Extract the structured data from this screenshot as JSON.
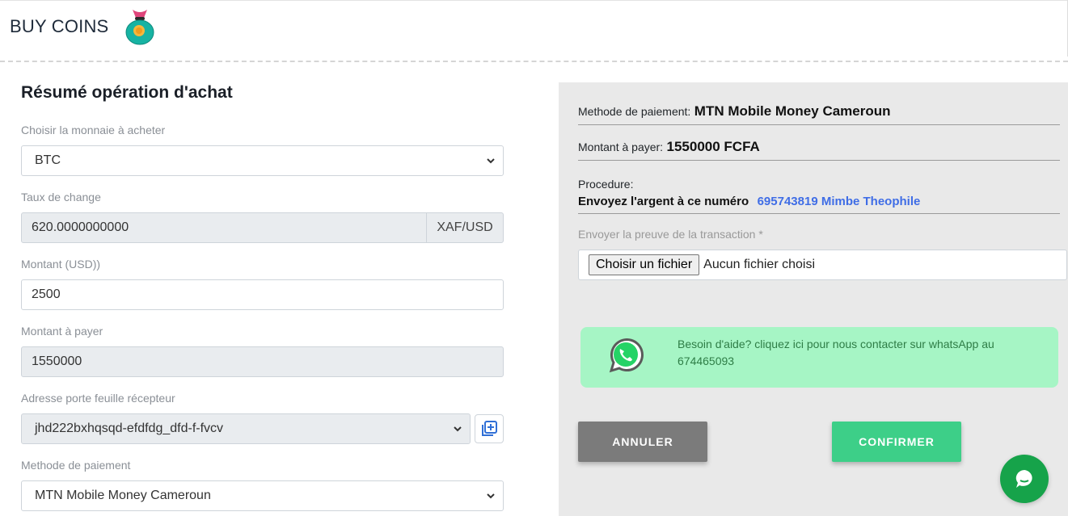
{
  "header": {
    "title": "BUY COINS",
    "icon": "money-bag-icon"
  },
  "form": {
    "section_title": "Résumé opération d'achat",
    "currency": {
      "label": "Choisir la monnaie à acheter",
      "value": "BTC"
    },
    "rate": {
      "label": "Taux de change",
      "value": "620.0000000000",
      "unit": "XAF/USD"
    },
    "amount_usd": {
      "label": "Montant (USD))",
      "value": "2500"
    },
    "amount_pay": {
      "label": "Montant à payer",
      "value": "1550000"
    },
    "wallet": {
      "label": "Adresse porte feuille récepteur",
      "value": "jhd222bxhqsqd-efdfdg_dfd-f-fvcv"
    },
    "payment_method": {
      "label": "Methode de paiement",
      "value": "MTN Mobile Money Cameroun"
    }
  },
  "summary": {
    "method_label": "Methode de paiement:",
    "method_value": "MTN Mobile Money Cameroun",
    "amount_label": "Montant à payer:",
    "amount_value": "1550000 FCFA",
    "procedure_label": "Procedure:",
    "procedure_text": "Envoyez l'argent à ce numéro",
    "procedure_number": "695743819 Mimbe Theophile",
    "proof_label": "Envoyer la preuve de la transaction *",
    "file_button": "Choisir un fichier",
    "file_status": "Aucun fichier choisi",
    "help_text": "Besoin d'aide? cliquez ici pour nous contacter sur whatsApp au 674465093"
  },
  "actions": {
    "cancel": "ANNULER",
    "confirm": "CONFIRMER"
  },
  "colors": {
    "accent_green": "#3dcf88",
    "help_bg": "#a6f5c5",
    "link_blue": "#3f6de6",
    "chat_green": "#16a34a"
  }
}
